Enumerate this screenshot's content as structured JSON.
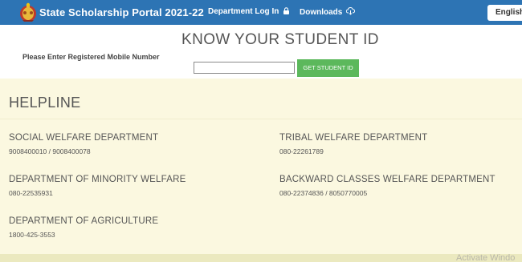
{
  "header": {
    "title": "State Scholarship Portal 2021-22",
    "nav": {
      "department_login": "Department Log In",
      "downloads": "Downloads"
    },
    "language_button": "English",
    "colors": {
      "bar": "#2d74b4",
      "text": "#ffffff"
    }
  },
  "student_id": {
    "heading": "KNOW YOUR STUDENT ID",
    "mobile_label": "Please Enter Registered Mobile Number",
    "mobile_value": "",
    "button_label": "GET STUDENT ID",
    "button_color": "#5cb85c"
  },
  "helpline": {
    "title": "HELPLINE",
    "background": "#fbf8e0",
    "departments": [
      {
        "name": "SOCIAL WELFARE DEPARTMENT",
        "phone": "9008400010 / 9008400078"
      },
      {
        "name": "TRIBAL WELFARE DEPARTMENT",
        "phone": "080-22261789"
      },
      {
        "name": "DEPARTMENT OF MINORITY WELFARE",
        "phone": "080-22535931"
      },
      {
        "name": "BACKWARD CLASSES WELFARE DEPARTMENT",
        "phone": "080-22374836 / 8050770005"
      },
      {
        "name": "DEPARTMENT OF AGRICULTURE",
        "phone": "1800-425-3553"
      }
    ]
  },
  "watermark": "Activate Windo"
}
